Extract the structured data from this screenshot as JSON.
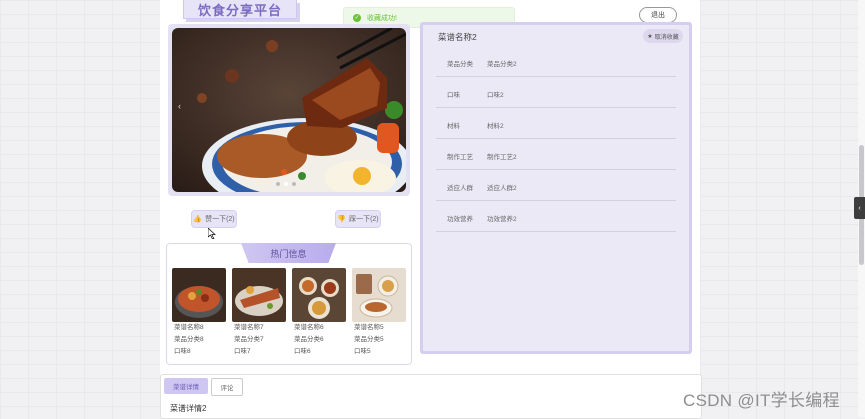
{
  "header": {
    "logo_text": "饮食分享平台",
    "toast_text": "收藏成功!",
    "logout_label": "退出"
  },
  "carousel": {
    "prev_arrow": "‹",
    "slide_count": 3,
    "active_slide": 1
  },
  "votes": {
    "like_label": "赞一下(2)",
    "dislike_label": "踩一下(2)"
  },
  "hot": {
    "title": "热门信息",
    "items": [
      {
        "name": "菜谱名称8",
        "category": "菜品分类8",
        "taste": "口味8"
      },
      {
        "name": "菜谱名称7",
        "category": "菜品分类7",
        "taste": "口味7"
      },
      {
        "name": "菜谱名称6",
        "category": "菜品分类6",
        "taste": "口味6"
      },
      {
        "name": "菜谱名称5",
        "category": "菜品分类5",
        "taste": "口味5"
      }
    ]
  },
  "detail": {
    "name": "菜谱名称2",
    "fav_label": "取消收藏",
    "fields": [
      {
        "key": "菜品分类",
        "value": "菜品分类2"
      },
      {
        "key": "口味",
        "value": "口味2"
      },
      {
        "key": "材料",
        "value": "材料2"
      },
      {
        "key": "制作工艺",
        "value": "制作工艺2"
      },
      {
        "key": "适应人群",
        "value": "适应人群2"
      },
      {
        "key": "功效营养",
        "value": "功效营养2"
      }
    ]
  },
  "tabs": {
    "detail_tab": "菜谱详情",
    "comment_tab": "评论",
    "detail_title": "菜谱详情2"
  },
  "side_toggle": "‹",
  "watermark": "CSDN @IT学长编程",
  "colors": {
    "accent": "#cfc7f2",
    "accent_text": "#7b6cc2",
    "success": "#67c23a"
  }
}
